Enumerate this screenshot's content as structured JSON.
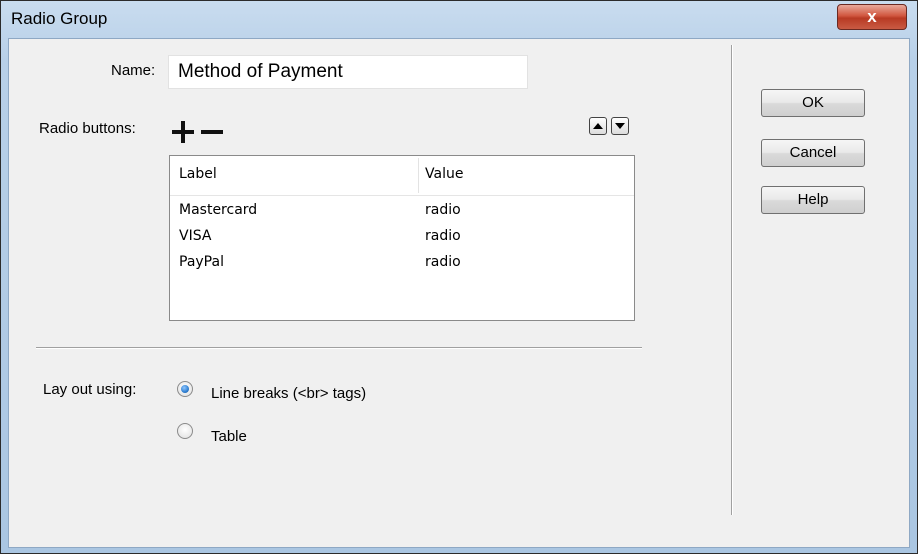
{
  "window": {
    "title": "Radio Group",
    "close_glyph": "x"
  },
  "form": {
    "name_label": "Name:",
    "name_value": "Method of Payment",
    "radio_buttons_label": "Radio buttons:",
    "add_icon": "plus-icon",
    "remove_icon": "minus-icon",
    "move_up_icon": "arrow-up-icon",
    "move_down_icon": "arrow-down-icon"
  },
  "table": {
    "columns": [
      "Label",
      "Value"
    ],
    "rows": [
      {
        "label": "Mastercard",
        "value": "radio"
      },
      {
        "label": "VISA",
        "value": "radio"
      },
      {
        "label": "PayPal",
        "value": "radio"
      }
    ]
  },
  "layout_options": {
    "label": "Lay out using:",
    "options": [
      {
        "label": "Line breaks (<br> tags)",
        "checked": true
      },
      {
        "label": "Table",
        "checked": false
      }
    ]
  },
  "buttons": {
    "ok": "OK",
    "cancel": "Cancel",
    "help": "Help"
  },
  "colors": {
    "radio_selected": "#2f7fd1",
    "close_button": "#c7452e"
  }
}
